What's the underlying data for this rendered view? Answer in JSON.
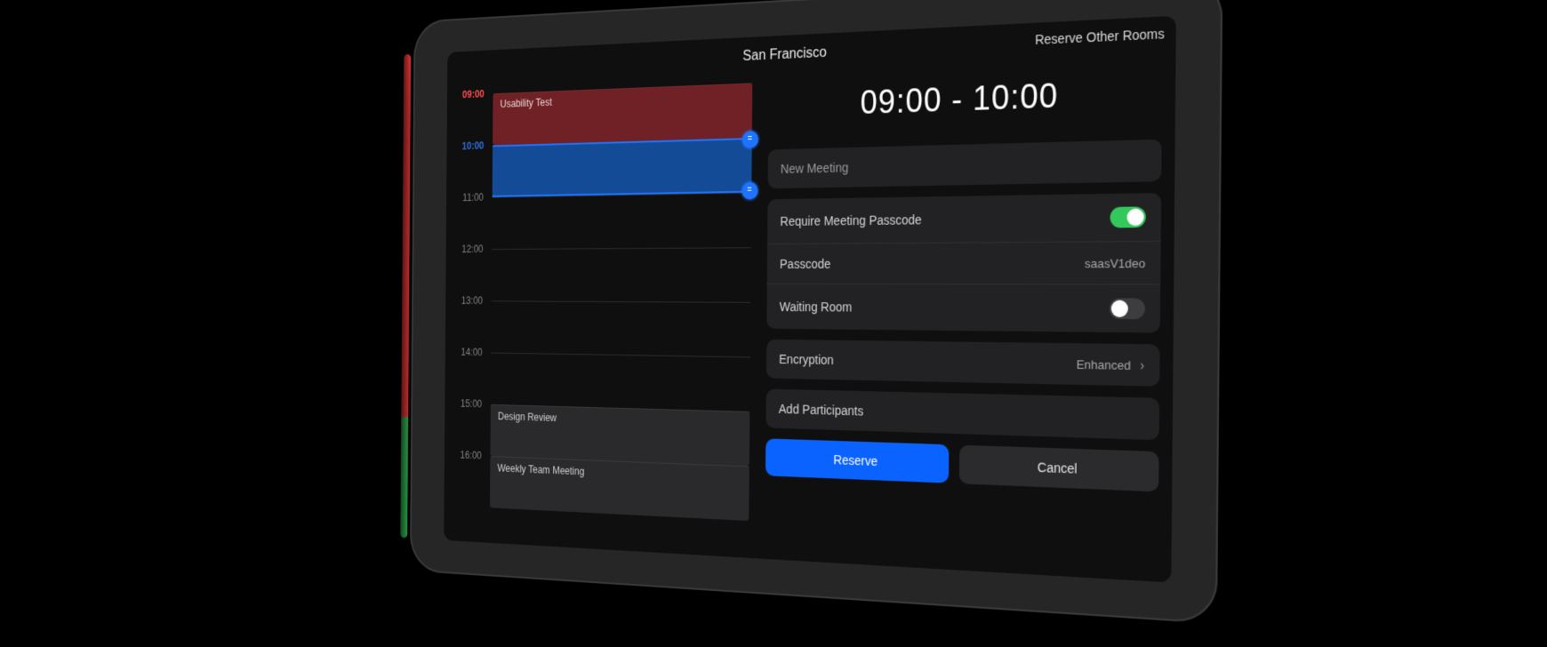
{
  "room": {
    "name": "San Francisco"
  },
  "header": {
    "reserve_other": "Reserve Other Rooms"
  },
  "timeline": {
    "hours": [
      "09:00",
      "10:00",
      "11:00",
      "12:00",
      "13:00",
      "14:00",
      "15:00",
      "16:00"
    ],
    "current_hour": "09:00",
    "selection_start": "10:00",
    "selection_end": "11:00",
    "events": [
      {
        "title": "Usability Test",
        "start": "09:00",
        "end": "10:00",
        "busy": true
      },
      {
        "title": "Design Review",
        "start": "15:00",
        "end": "16:00",
        "busy": false
      },
      {
        "title": "Weekly Team Meeting",
        "start": "16:00",
        "end": "17:00",
        "busy": false
      }
    ]
  },
  "form": {
    "time_range": "09:00 - 10:00",
    "topic_placeholder": "New Meeting",
    "require_passcode_label": "Require Meeting Passcode",
    "require_passcode_on": true,
    "passcode_label": "Passcode",
    "passcode_value": "saasV1deo",
    "waiting_room_label": "Waiting Room",
    "waiting_room_on": false,
    "encryption_label": "Encryption",
    "encryption_value": "Enhanced",
    "add_participants_label": "Add Participants",
    "reserve_label": "Reserve",
    "cancel_label": "Cancel"
  },
  "colors": {
    "accent": "#0a63ff",
    "busy": "#96282e",
    "led_busy": "#ff3b3b",
    "led_free": "#34c759"
  }
}
